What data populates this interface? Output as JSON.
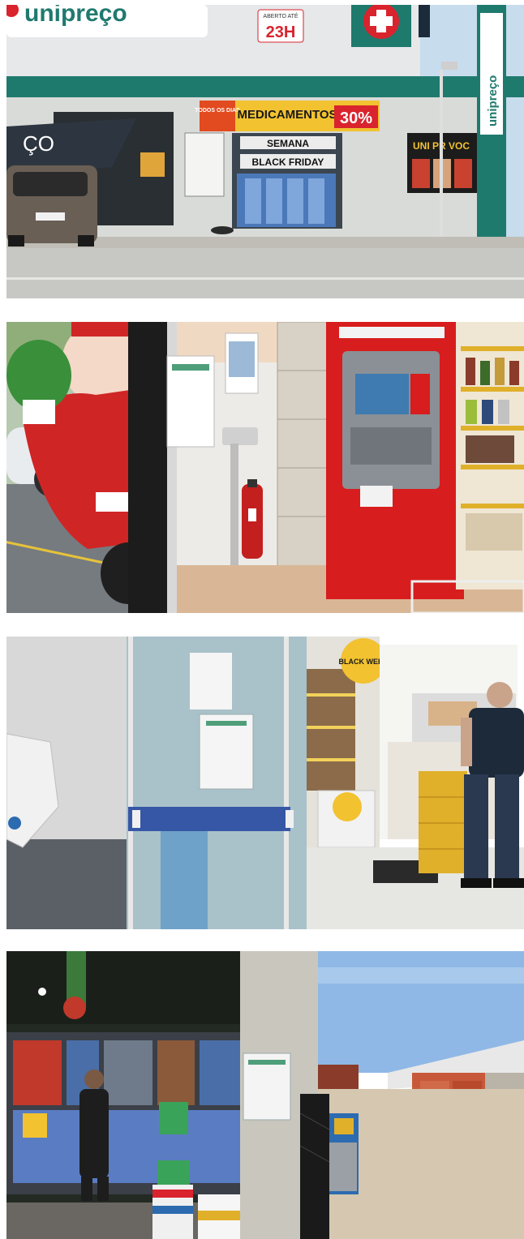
{
  "photos": [
    {
      "signs": {
        "brand_top": "unipreço",
        "open_label": "ABERTO ATÉ",
        "hours": "23H",
        "promo_left": "TODOS OS DIAS",
        "promo_main": "MEDICAMENTOS",
        "promo_percent": "30%",
        "window_line1": "SEMANA",
        "window_line2": "BLACK FRIDAY",
        "side_brand": "unipreço",
        "shop_left": "ÇO",
        "vertical_ad": "UNI PR VOC"
      }
    },
    {
      "signs": {
        "atm_banner": ""
      }
    },
    {
      "signs": {
        "door_notice": "",
        "badge": "BLACK WEEK"
      }
    },
    {
      "signs": {
        "column_notice": ""
      }
    }
  ]
}
